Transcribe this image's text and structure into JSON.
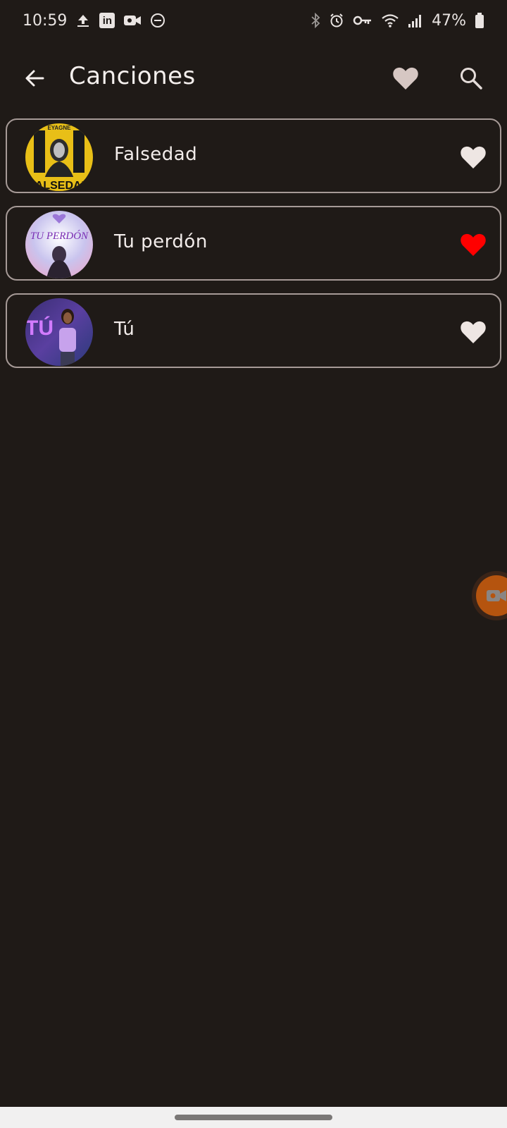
{
  "status_bar": {
    "time": "10:59",
    "battery_percent": "47%",
    "left_icons": [
      "upload-icon",
      "linkedin-icon",
      "video-camera-icon",
      "do-not-disturb-icon"
    ],
    "right_icons": [
      "bluetooth-icon",
      "alarm-icon",
      "vpn-key-icon",
      "wifi-icon",
      "signal-icon",
      "battery-icon"
    ]
  },
  "app_bar": {
    "title": "Canciones",
    "back_icon": "arrow-back-icon",
    "favorites_icon": "heart-icon",
    "search_icon": "search-icon"
  },
  "colors": {
    "background": "#1f1a17",
    "card_border": "#a69a97",
    "heart_inactive": "#eee6e3",
    "heart_active": "#ff0000",
    "recorder_bubble": "#b5540f"
  },
  "songs": [
    {
      "title": "Falsedad",
      "cover_text": "FALSEDAD",
      "cover_artist": "EYAGNE",
      "favorite": false
    },
    {
      "title": "Tu perdón",
      "cover_text": "TU PERDÓN",
      "favorite": true
    },
    {
      "title": "Tú",
      "cover_text": "TÚ",
      "favorite": false
    }
  ]
}
